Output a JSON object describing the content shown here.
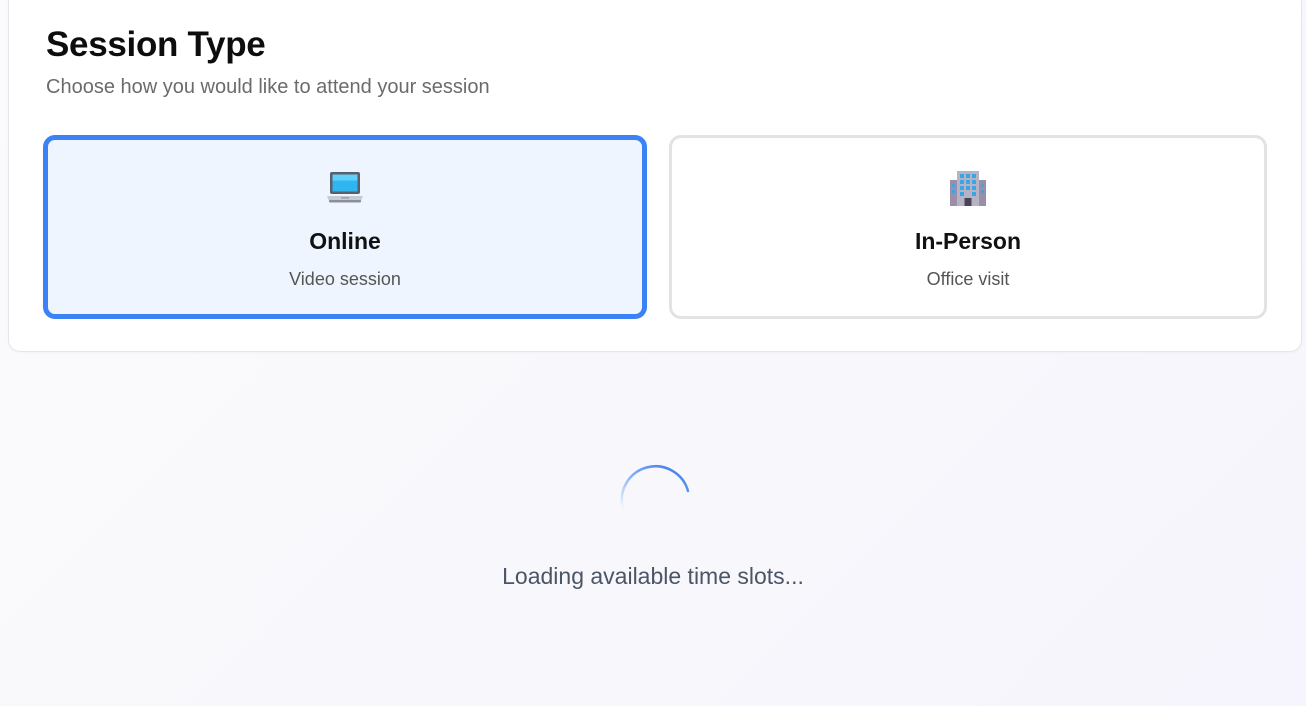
{
  "session_type": {
    "title": "Session Type",
    "subtitle": "Choose how you would like to attend your session",
    "options": [
      {
        "icon": "laptop-icon",
        "label": "Online",
        "description": "Video session",
        "selected": true
      },
      {
        "icon": "office-building-icon",
        "label": "In-Person",
        "description": "Office visit",
        "selected": false
      }
    ]
  },
  "loading": {
    "message": "Loading available time slots..."
  },
  "colors": {
    "accent": "#3b82f6",
    "selected_background": "#eff5fe",
    "card_border": "#e3e3e6",
    "loading_text": "#4a5566"
  }
}
